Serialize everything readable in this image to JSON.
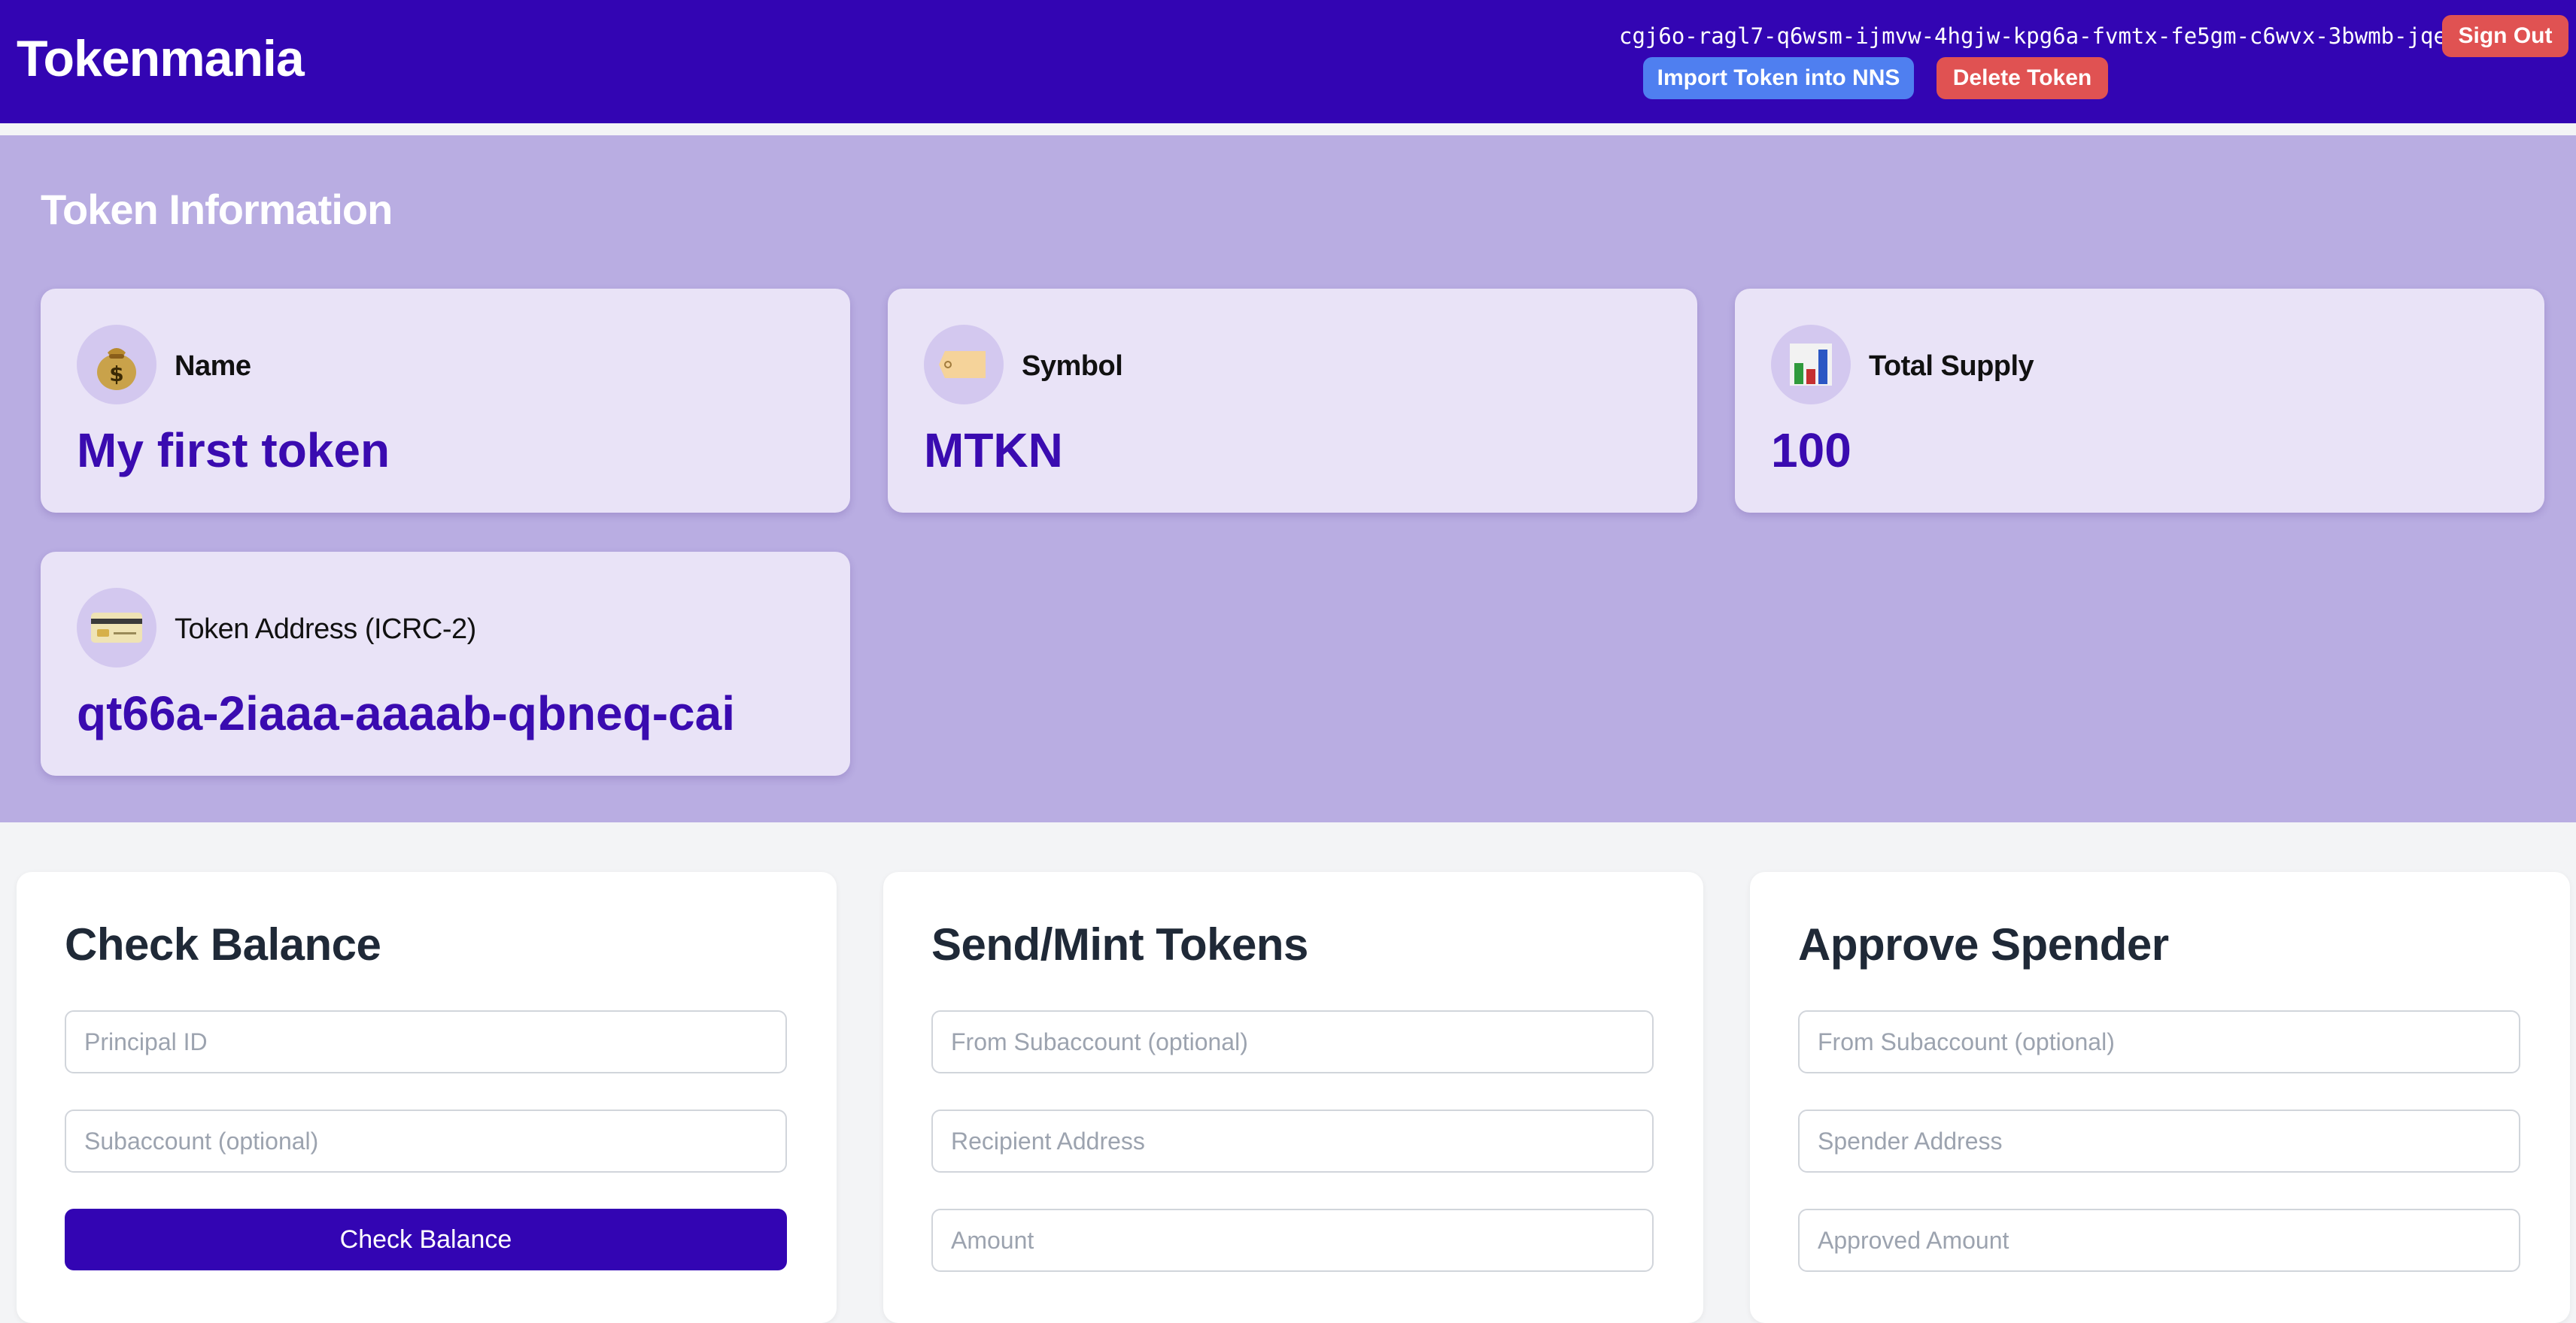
{
  "header": {
    "brand": "Tokenmania",
    "principal": "cgj6o-ragl7-q6wsm-ijmvw-4hgjw-kpg6a-fvmtx-fe5gm-c6wvx-3bwmb-jqe",
    "sign_out_label": "Sign Out",
    "import_label": "Import Token into NNS",
    "delete_label": "Delete Token"
  },
  "token_info": {
    "title": "Token Information",
    "cards": [
      {
        "label": "Name",
        "value": "My first token",
        "icon": "money-bag-icon"
      },
      {
        "label": "Symbol",
        "value": "MTKN",
        "icon": "tag-icon"
      },
      {
        "label": "Total Supply",
        "value": "100",
        "icon": "bar-chart-icon"
      },
      {
        "label": "Token Address (ICRC-2)",
        "value": "qt66a-2iaaa-aaaab-qbneq-cai",
        "icon": "credit-card-icon"
      }
    ]
  },
  "panels": {
    "check_balance": {
      "title": "Check Balance",
      "principal_placeholder": "Principal ID",
      "subaccount_placeholder": "Subaccount (optional)",
      "button_label": "Check Balance"
    },
    "send_mint": {
      "title": "Send/Mint Tokens",
      "from_placeholder": "From Subaccount (optional)",
      "recipient_placeholder": "Recipient Address",
      "amount_placeholder": "Amount"
    },
    "approve_spender": {
      "title": "Approve Spender",
      "from_placeholder": "From Subaccount (optional)",
      "spender_placeholder": "Spender Address",
      "amount_placeholder": "Approved Amount"
    }
  },
  "colors": {
    "header_bg": "#3305b3",
    "info_band_bg": "#b9ade2",
    "card_bg": "#e9e3f7",
    "value_text": "#3a0bb0",
    "danger": "#e05252",
    "import_blue": "#4f7ff0",
    "primary_button": "#3305b3"
  }
}
